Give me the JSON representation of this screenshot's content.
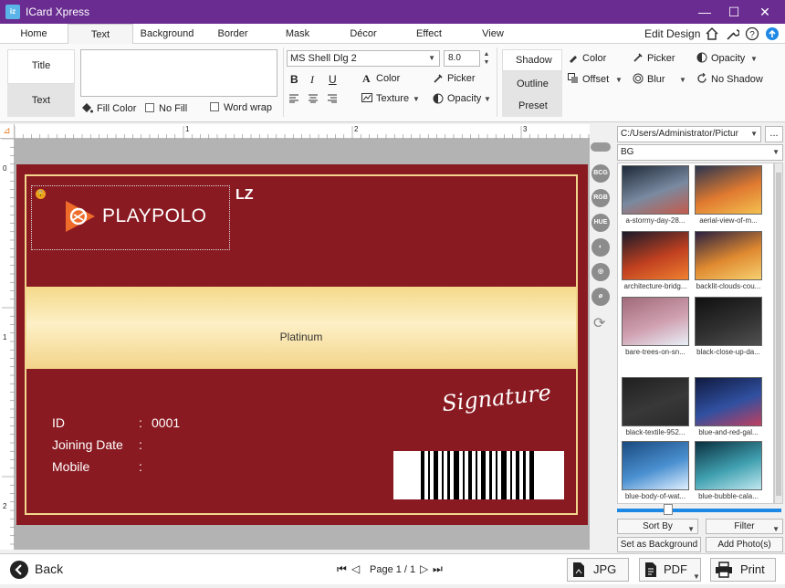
{
  "window": {
    "title": "ICard Xpress",
    "app_icon_text": "iz",
    "minimize": "—",
    "maximize": "☐",
    "close": "✕"
  },
  "tabs": [
    "Home",
    "Text",
    "Background",
    "Border",
    "Mask",
    "Décor",
    "Effect",
    "View"
  ],
  "header_right": {
    "edit_design": "Edit Design"
  },
  "ribbon": {
    "side_tabs": [
      "Title",
      "Text"
    ],
    "fill_color": "Fill Color",
    "no_fill": "No Fill",
    "word_wrap": "Word wrap",
    "font_name": "MS Shell Dlg 2",
    "font_size": "8.0",
    "bold": "B",
    "italic": "I",
    "underline": "U",
    "color": "Color",
    "texture": "Texture",
    "picker": "Picker",
    "opacity": "Opacity",
    "shadow_tabs": [
      "Shadow",
      "Outline",
      "Preset"
    ],
    "shadow_color": "Color",
    "shadow_offset": "Offset",
    "shadow_picker": "Picker",
    "shadow_blur": "Blur",
    "shadow_opacity": "Opacity",
    "no_shadow": "No Shadow"
  },
  "ruler": {
    "top": [
      "1",
      "2",
      "3"
    ],
    "left": [
      "0",
      "1",
      "2"
    ]
  },
  "card": {
    "logo_text": "PLAYPOLO",
    "corner_text": "LZ",
    "band_text": "Platinum",
    "signature": "Signature",
    "fields": [
      {
        "label": "ID",
        "sep": ":",
        "value": "0001"
      },
      {
        "label": "Joining Date",
        "sep": ":",
        "value": ""
      },
      {
        "label": "Mobile",
        "sep": ":",
        "value": ""
      }
    ],
    "colors": {
      "primary": "#8a1a22",
      "gold": "#f2d68c",
      "band_light": "#fdf0c6"
    }
  },
  "tools": [
    "BCG",
    "RGB",
    "HUE"
  ],
  "right_panel": {
    "path": "C:/Users/Administrator/Pictur",
    "more": "...",
    "category": "BG",
    "thumbnails": [
      {
        "caption": "a-stormy-day-28...",
        "colors": [
          "#1e2a3a",
          "#7a8aa0",
          "#c45a4a"
        ]
      },
      {
        "caption": "aerial-view-of-m...",
        "colors": [
          "#2a3550",
          "#e07a30",
          "#f4c050"
        ]
      },
      {
        "caption": "architecture-bridg...",
        "colors": [
          "#1a1a2a",
          "#c04020",
          "#f08030"
        ]
      },
      {
        "caption": "backlit-clouds-cou...",
        "colors": [
          "#2a2040",
          "#e08a30",
          "#f6d070"
        ]
      },
      {
        "caption": "bare-trees-on-sn...",
        "colors": [
          "#a06a7a",
          "#d0a0b0",
          "#e8f0f8"
        ]
      },
      {
        "caption": "black-close-up-da...",
        "colors": [
          "#101010",
          "#303030",
          "#505050"
        ]
      },
      {
        "caption": "black-textile-952...",
        "colors": [
          "#202020",
          "#383838",
          "#2a2a2a"
        ]
      },
      {
        "caption": "blue-and-red-gal...",
        "colors": [
          "#101a40",
          "#3050a0",
          "#c04060"
        ]
      },
      {
        "caption": "blue-body-of-wat...",
        "colors": [
          "#1a4a80",
          "#4a90d0",
          "#e0f0ff"
        ]
      },
      {
        "caption": "blue-bubble-cala...",
        "colors": [
          "#0a3040",
          "#40a0b0",
          "#c0e8f0"
        ]
      }
    ],
    "sort_by": "Sort By",
    "filter": "Filter",
    "set_bg": "Set as Background",
    "add_photos": "Add Photo(s)",
    "slider_value": 0.3
  },
  "bottom": {
    "back": "Back",
    "page": "Page 1 / 1",
    "jpg": "JPG",
    "pdf": "PDF",
    "print": "Print"
  }
}
